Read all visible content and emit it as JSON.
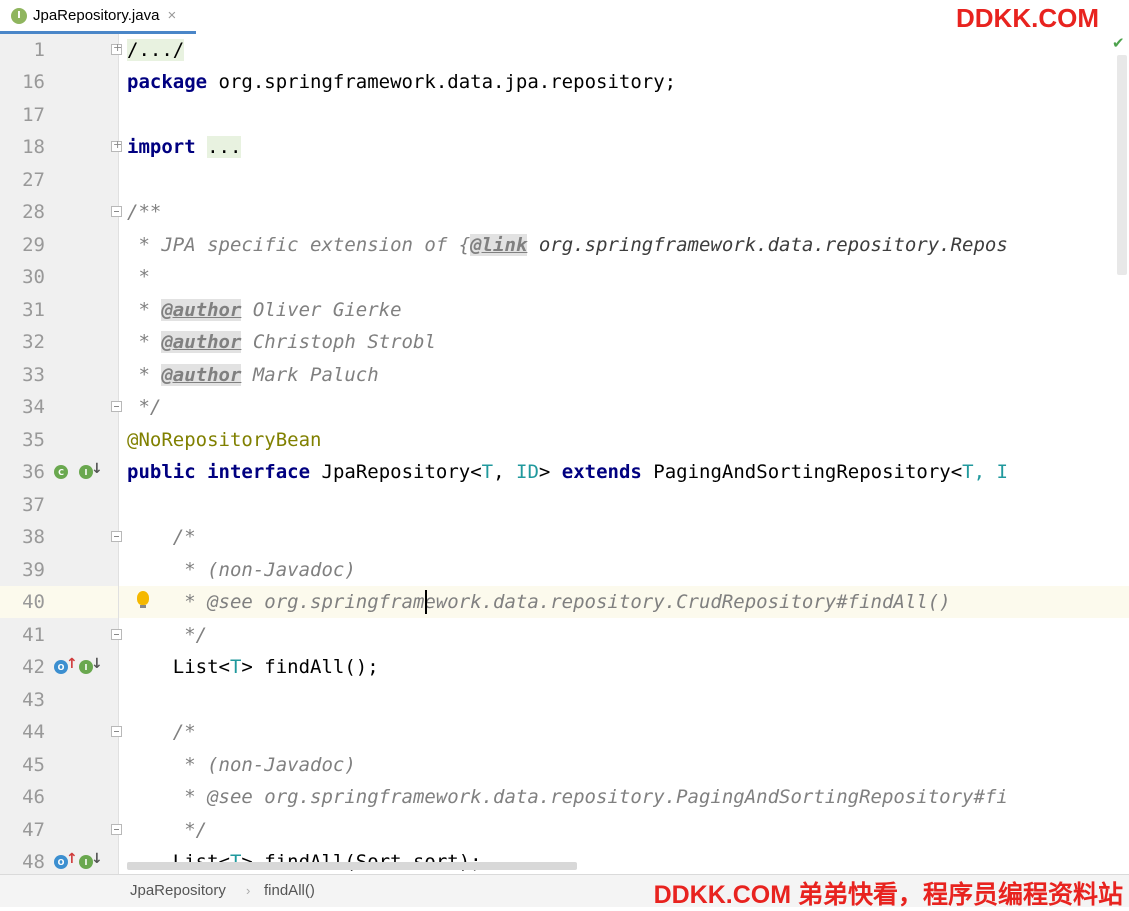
{
  "tab": {
    "label": "JpaRepository.java",
    "icon_letter": "I",
    "close": "×"
  },
  "watermark_top": "DDKK.COM",
  "watermark_bottom": "DDKK.COM 弟弟快看，程序员编程资料站",
  "breadcrumb": {
    "items": [
      "JpaRepository",
      "findAll()"
    ],
    "separator": "›"
  },
  "gutter_icon_letters": {
    "class": "C",
    "interface": "I",
    "override": "O"
  },
  "lines": [
    {
      "num": "1"
    },
    {
      "num": "16"
    },
    {
      "num": "17"
    },
    {
      "num": "18"
    },
    {
      "num": "27"
    },
    {
      "num": "28"
    },
    {
      "num": "29"
    },
    {
      "num": "30"
    },
    {
      "num": "31"
    },
    {
      "num": "32"
    },
    {
      "num": "33"
    },
    {
      "num": "34"
    },
    {
      "num": "35"
    },
    {
      "num": "36"
    },
    {
      "num": "37"
    },
    {
      "num": "38"
    },
    {
      "num": "39"
    },
    {
      "num": "40"
    },
    {
      "num": "41"
    },
    {
      "num": "42"
    },
    {
      "num": "43"
    },
    {
      "num": "44"
    },
    {
      "num": "45"
    },
    {
      "num": "46"
    },
    {
      "num": "47"
    },
    {
      "num": "48"
    }
  ],
  "code": {
    "l1": "/.../",
    "l16_kw": "package",
    "l16_rest": " org.springframework.data.jpa.repository;",
    "l18_kw": "import",
    "l18_fold": "...",
    "l28": "/**",
    "l29_a": " * JPA specific extension of {",
    "l29_tag": "@link",
    "l29_ref": " org.springframework.data.repository.Repos",
    "l30": " *",
    "author_prefix": " * ",
    "author_tag": "@author",
    "l31_name": " Oliver Gierke",
    "l32_name": " Christoph Strobl",
    "l33_name": " Mark Paluch",
    "l34": " */",
    "l35": "@NoRepositoryBean",
    "l36_kw1": "public",
    "l36_kw2": "interface",
    "l36_name": "JpaRepository<",
    "l36_t": "T",
    "l36_comma": ", ",
    "l36_id": "ID",
    "l36_gt": "> ",
    "l36_kw3": "extends",
    "l36_super": " PagingAndSortingRepository<",
    "l36_t2": "T",
    "l36_tail": ", I",
    "l38": "    /*",
    "l39": "     * (non-Javadoc)",
    "l40": "     * @see org.springframework.data.repository.CrudRepository#findAll()",
    "l41": "     */",
    "l42_a": "    List<",
    "l42_t": "T",
    "l42_b": "> findAll();",
    "l44": "    /*",
    "l45": "     * (non-Javadoc)",
    "l46": "     * @see org.springframework.data.repository.PagingAndSortingRepository#fi",
    "l47": "     */",
    "l48_a": "    List<",
    "l48_t": "T",
    "l48_b": "> findAll(Sort sort);"
  }
}
